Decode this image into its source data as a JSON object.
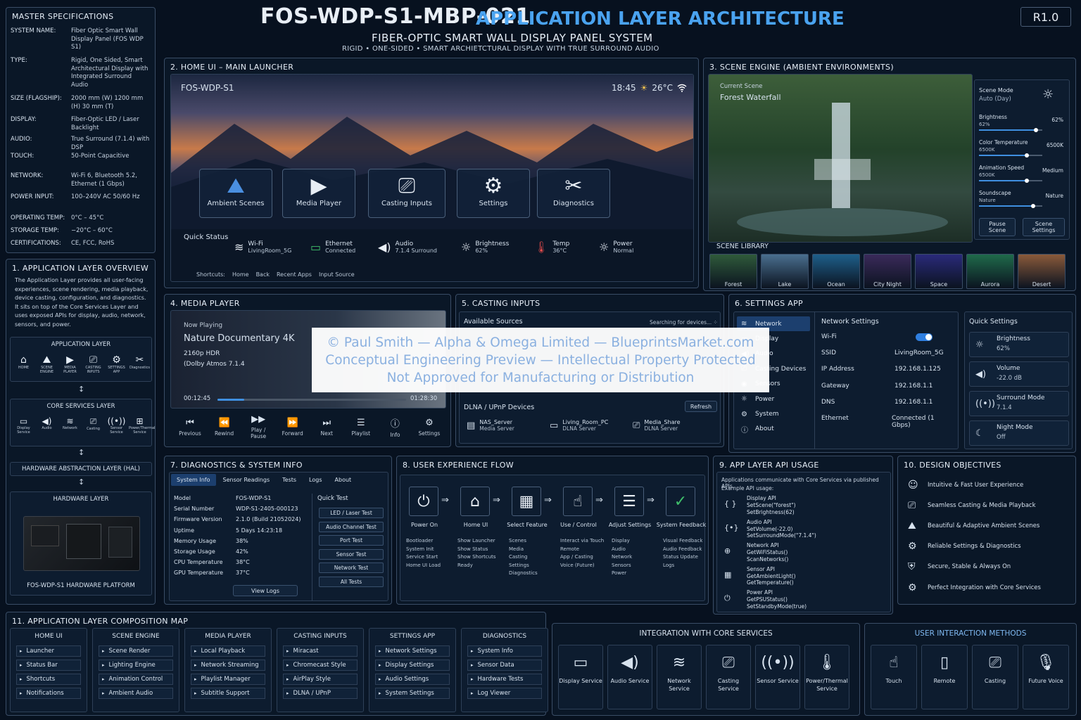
{
  "header": {
    "code": "FOS-WDP-S1-MBP-021",
    "title": "APPLICATION LAYER ARCHITECTURE",
    "subtitle": "FIBER-OPTIC SMART WALL DISPLAY PANEL SYSTEM",
    "tagline": "RIGID • ONE-SIDED • SMART ARCHIETCTURAL DISPLAY WITH TRUE SURROUND AUDIO",
    "rev": "R1.0"
  },
  "master": {
    "title": "MASTER SPECIFICATIONS",
    "rows": [
      {
        "k": "SYSTEM NAME:",
        "v": "Fiber Optic Smart Wall Display Panel (FOS WDP S1)"
      },
      {
        "k": "TYPE:",
        "v": "Rigid, One Sided, Smart Architectural Display with Integrated Surround Audio"
      },
      {
        "k": "SIZE (FLAGSHIP):",
        "v": "2000 mm (W) 1200 mm (H) 30 mm (T)"
      },
      {
        "k": "DISPLAY:",
        "v": "Fiber-Optic LED / Laser Backlight"
      },
      {
        "k": "AUDIO:",
        "v": "True Surround (7.1.4) with DSP"
      },
      {
        "k": "TOUCH:",
        "v": "50-Point Capacitive"
      },
      {
        "k": "NETWORK:",
        "v": "Wi-Fi 6, Bluetooth 5.2, Ethernet (1 Gbps)"
      },
      {
        "k": "POWER INPUT:",
        "v": "100–240V AC 50/60 Hz"
      },
      {
        "k": "OPERATING TEMP:",
        "v": "0°C – 45°C"
      },
      {
        "k": "STORAGE TEMP:",
        "v": "−20°C – 60°C"
      },
      {
        "k": "CERTIFICATIONS:",
        "v": "CE, FCC, RoHS"
      }
    ]
  },
  "overview": {
    "title": "1. APPLICATION LAYER OVERVIEW",
    "text": "The Application Layer provides all user-facing experiences, scene rendering, media playback, device casting, configuration, and diagnostics. It sits on top of the Core Services Layer and uses exposed APIs for display, audio, network, sensors, and power.",
    "app_layer": "APPLICATION LAYER",
    "app_items": [
      "HOME",
      "SCENE ENGINE",
      "MEDIA PLAYER",
      "CASTING INPUTS",
      "SETTINGS APP",
      "Diagnostics"
    ],
    "core_layer": "CORE SERVICES LAYER",
    "core_items": [
      "Display Service",
      "Audio",
      "Network",
      "Casting",
      "Sensor Service",
      "Power/Thermal Service"
    ],
    "hal": "HARDWARE ABSTRACTION LAYER (HAL)",
    "hw": "HARDWARE LAYER",
    "hw_caption": "FOS-WDP-S1 HARDWARE PLATFORM"
  },
  "home": {
    "title": "2. HOME UI – MAIN LAUNCHER",
    "device": "FOS-WDP-S1",
    "time": "18:45",
    "temp": "26°C",
    "tiles": [
      "Ambient Scenes",
      "Media Player",
      "Casting Inputs",
      "Settings",
      "Diagnostics"
    ],
    "qs_title": "Quick Status",
    "status": [
      {
        "n": "Wi-Fi",
        "v": "LivingRoom_5G"
      },
      {
        "n": "Ethernet",
        "v": "Connected"
      },
      {
        "n": "Audio",
        "v": "7.1.4 Surround"
      },
      {
        "n": "Brightness",
        "v": "62%"
      },
      {
        "n": "Temp",
        "v": "36°C"
      },
      {
        "n": "Power",
        "v": "Normal"
      }
    ],
    "shortcuts": [
      "Shortcuts:",
      "Home",
      "Back",
      "Recent Apps",
      "Input Source"
    ]
  },
  "scene": {
    "title": "3. SCENE ENGINE (AMBIENT ENVIRONMENTS)",
    "cur_label": "Current Scene",
    "cur": "Forest Waterfall",
    "mode_label": "Scene Mode",
    "mode": "Auto (Day)",
    "sliders": [
      {
        "n": "Brightness",
        "v": "62%",
        "s": "62%",
        "f": 0.9
      },
      {
        "n": "Color Temperature",
        "v": "6500K",
        "s": "6500K",
        "f": 0.75
      },
      {
        "n": "Animation Speed",
        "v": "Medium",
        "s": "6500K",
        "f": 0.75
      },
      {
        "n": "Soundscape",
        "v": "Nature",
        "s": "Nature",
        "f": 0.85
      }
    ],
    "btns": [
      "Pause Scene",
      "Scene Settings"
    ],
    "lib_title": "SCENE LIBRARY",
    "library": [
      {
        "n": "Forest",
        "c": "#2f5a3a"
      },
      {
        "n": "Lake",
        "c": "#4a6f8f"
      },
      {
        "n": "Ocean",
        "c": "#1e5f8a"
      },
      {
        "n": "City Night",
        "c": "#3a2a5a"
      },
      {
        "n": "Space",
        "c": "#2a2a7a"
      },
      {
        "n": "Aurora",
        "c": "#1f6a4a"
      },
      {
        "n": "Desert",
        "c": "#8a5a3a"
      }
    ]
  },
  "media": {
    "title": "4. MEDIA PLAYER",
    "np": "Now Playing",
    "name": "Nature Documentary 4K",
    "q": "2160p HDR",
    "audio": "(Dolby Atmos 7.1.4",
    "pos": "00:12:45",
    "dur": "01:28:30",
    "progress": 0.14,
    "ctrls": [
      "Previous",
      "Rewind",
      "Play / Pause",
      "Forward",
      "Next",
      "Playlist",
      "Info",
      "Settings"
    ]
  },
  "cast": {
    "title": "5. CASTING INPUTS",
    "avail": "Available Sources",
    "searching": "Searching for devices...",
    "dlna": "DLNA / UPnP Devices",
    "refresh": "Refresh",
    "devices": [
      {
        "n": "NAS_Server",
        "t": "Media Server"
      },
      {
        "n": "Living_Room_PC",
        "t": "DLNA Server"
      },
      {
        "n": "Media_Share",
        "t": "DLNA Server"
      }
    ]
  },
  "settings": {
    "title": "6. SETTINGS APP",
    "menu": [
      "Network",
      "Display",
      "Audio",
      "Casting Devices",
      "Sensors",
      "Power",
      "System",
      "About"
    ],
    "net_title": "Network Settings",
    "rows": [
      {
        "k": "Wi-Fi",
        "v": ""
      },
      {
        "k": "SSID",
        "v": "LivingRoom_5G"
      },
      {
        "k": "IP Address",
        "v": "192.168.1.125"
      },
      {
        "k": "Gateway",
        "v": "192.168.1.1"
      },
      {
        "k": "DNS",
        "v": "192.168.1.1"
      },
      {
        "k": "Ethernet",
        "v": "Connected (1 Gbps)"
      }
    ],
    "qs_title": "Quick Settings",
    "qs": [
      {
        "n": "Brightness",
        "v": "62%"
      },
      {
        "n": "Volume",
        "v": "-22.0 dB"
      },
      {
        "n": "Surround Mode",
        "v": "7.1.4"
      },
      {
        "n": "Night Mode",
        "v": "Off"
      }
    ]
  },
  "diag": {
    "title": "7. DIAGNOSTICS & SYSTEM INFO",
    "tabs": [
      "System Info",
      "Sensor Readings",
      "Tests",
      "Logs",
      "About"
    ],
    "rows": [
      {
        "k": "Model",
        "v": "FOS-WDP-S1"
      },
      {
        "k": "Serial Number",
        "v": "WDP-S1-2405-000123"
      },
      {
        "k": "Firmware Version",
        "v": "2.1.0 (Build 21052024)"
      },
      {
        "k": "Uptime",
        "v": "5 Days 14:23:18"
      },
      {
        "k": "Memory Usage",
        "v": "38%"
      },
      {
        "k": "Storage Usage",
        "v": "42%"
      },
      {
        "k": "CPU Temperature",
        "v": "38°C"
      },
      {
        "k": "GPU Temperature",
        "v": "37°C"
      }
    ],
    "view_logs": "View Logs",
    "qt_title": "Quick Test",
    "tests": [
      "LED / Laser Test",
      "Audio Channel Test",
      "Port Test",
      "Sensor Test",
      "Network Test",
      "All Tests"
    ]
  },
  "ux": {
    "title": "8. USER EXPERIENCE FLOW",
    "steps": [
      {
        "n": "Power On",
        "d": [
          "Bootloader",
          "System Init",
          "Service Start",
          "Home UI Load"
        ]
      },
      {
        "n": "Home UI",
        "d": [
          "Show Launcher",
          "Show Status",
          "Show Shortcuts",
          "Ready"
        ]
      },
      {
        "n": "Select Feature",
        "d": [
          "Scenes",
          "Media",
          "Casting",
          "Settings",
          "Diagnostics"
        ]
      },
      {
        "n": "Use / Control",
        "d": [
          "Interact via Touch",
          "Remote",
          "App / Casting",
          "Voice (Future)"
        ]
      },
      {
        "n": "Adjust Settings",
        "d": [
          "Display",
          "Audio",
          "Network",
          "Sensors",
          "Power"
        ]
      },
      {
        "n": "System Feedback",
        "d": [
          "Visual Feedback",
          "Audio Feedback",
          "Status Update",
          "Logs"
        ]
      }
    ]
  },
  "api": {
    "title": "9. APP LAYER API USAGE",
    "intro": "Applications communicate with Core Services via published APIs.",
    "ex": "Example API usage:",
    "groups": [
      {
        "h": "Display API",
        "l": [
          "SetScene(\"forest\")",
          "SetBrightness(62)"
        ]
      },
      {
        "h": "Audio API",
        "l": [
          "SetVolume(-22.0)",
          "SetSurroundMode(\"7.1.4\")"
        ]
      },
      {
        "h": "Network API",
        "l": [
          "GetWiFiStatus()",
          "ScanNetworks()"
        ]
      },
      {
        "h": "Sensor API",
        "l": [
          "GetAmbientLight()",
          "GetTemperature()"
        ]
      },
      {
        "h": "Power API",
        "l": [
          "GetPSUStatus()",
          "SetStandbyMode(true)"
        ]
      }
    ]
  },
  "obj": {
    "title": "10. DESIGN OBJECTIVES",
    "items": [
      "Intuitive & Fast User Experience",
      "Seamless Casting & Media Playback",
      "Beautiful & Adaptive Ambient Scenes",
      "Reliable Settings & Diagnostics",
      "Secure, Stable & Always On",
      "Perfect Integration with Core Services"
    ]
  },
  "comp": {
    "title": "11. APPLICATION LAYER COMPOSITION MAP",
    "cols": [
      {
        "h": "HOME UI",
        "l": [
          "Launcher",
          "Status Bar",
          "Shortcuts",
          "Notifications"
        ]
      },
      {
        "h": "SCENE ENGINE",
        "l": [
          "Scene Render",
          "Lighting Engine",
          "Animation Control",
          "Ambient Audio"
        ]
      },
      {
        "h": "MEDIA PLAYER",
        "l": [
          "Local Playback",
          "Network Streaming",
          "Playlist Manager",
          "Subtitle Support"
        ]
      },
      {
        "h": "CASTING INPUTS",
        "l": [
          "Miracast",
          "Chromecast Style",
          "AirPlay Style",
          "DLNA / UPnP"
        ]
      },
      {
        "h": "SETTINGS APP",
        "l": [
          "Network Settings",
          "Display Settings",
          "Audio Settings",
          "System Settings"
        ]
      },
      {
        "h": "DIAGNOSTICS",
        "l": [
          "System Info",
          "Sensor Data",
          "Hardware Tests",
          "Log Viewer"
        ]
      }
    ]
  },
  "integ": {
    "title": "INTEGRATION WITH CORE SERVICES",
    "items": [
      "Display Service",
      "Audio Service",
      "Network Service",
      "Casting Service",
      "Sensor Service",
      "Power/Thermal Service"
    ]
  },
  "uim": {
    "title": "USER INTERACTION METHODS",
    "items": [
      "Touch",
      "Remote",
      "Casting",
      "Future Voice"
    ]
  },
  "watermark": {
    "l1": "© Paul Smith — Alpha & Omega Limited — BlueprintsMarket.com",
    "l2": "Conceptual Engineering Preview — Intellectual Property Protected",
    "l3": "Not Approved for Manufacturing or Distribution"
  }
}
